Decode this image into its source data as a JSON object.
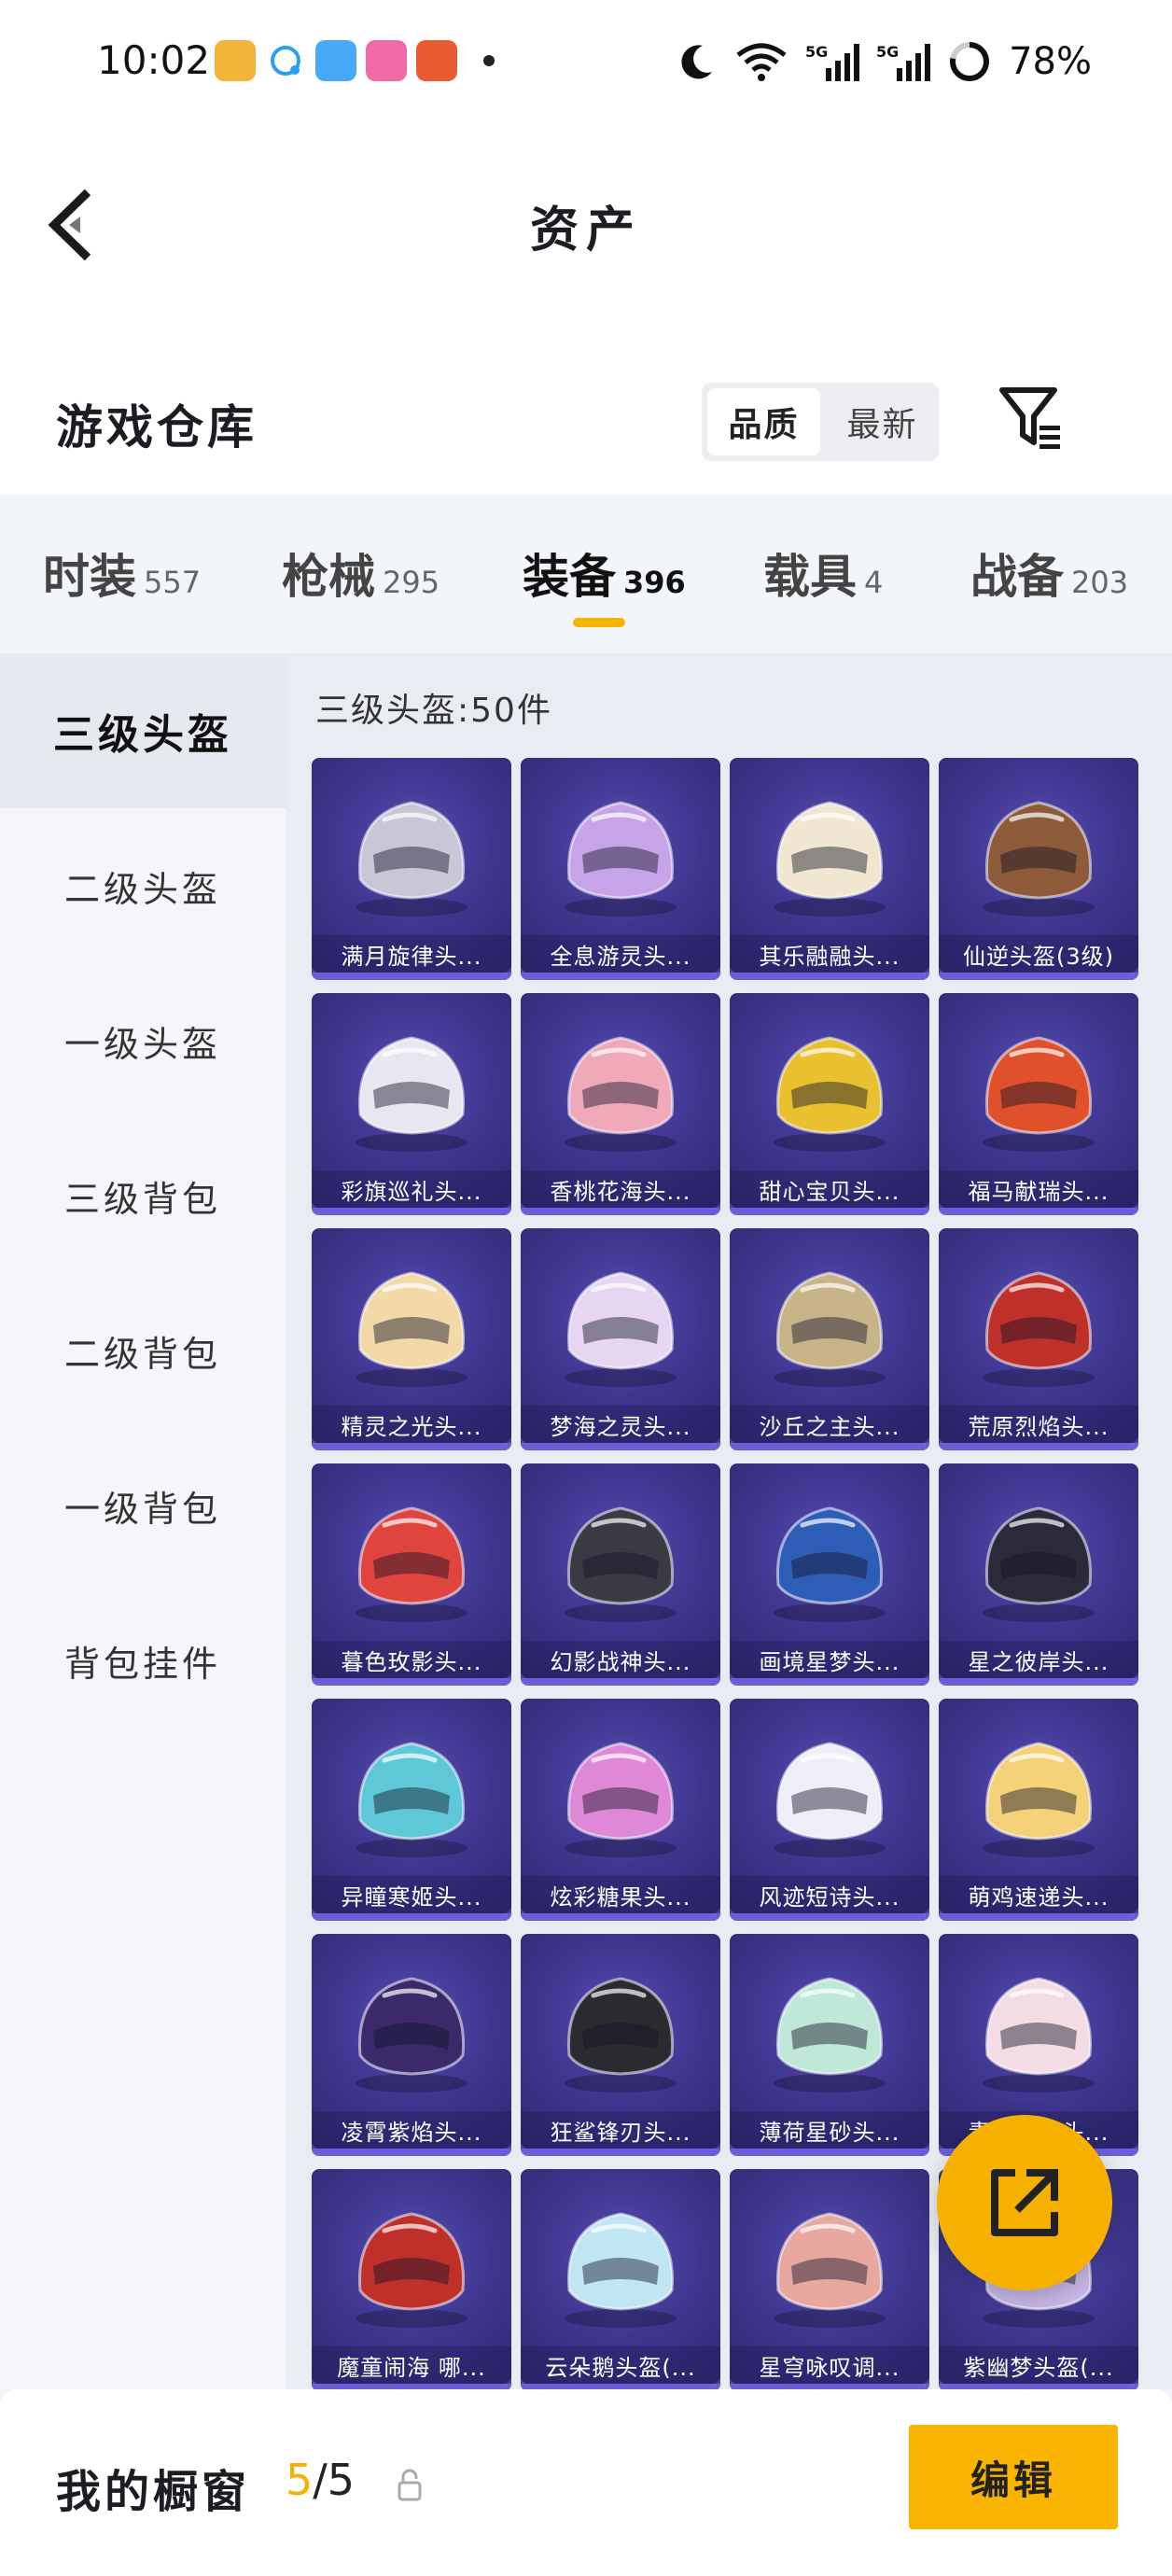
{
  "status_bar": {
    "time": "10:02",
    "battery": "78%",
    "network_1": "5G",
    "network_2": "5G"
  },
  "header": {
    "title": "资产"
  },
  "warehouse": {
    "title": "游戏仓库",
    "sort_options": [
      "品质",
      "最新"
    ],
    "active_sort": "品质"
  },
  "tabs": [
    {
      "label": "时装",
      "count": "557"
    },
    {
      "label": "枪械",
      "count": "295"
    },
    {
      "label": "装备",
      "count": "396"
    },
    {
      "label": "载具",
      "count": "4"
    },
    {
      "label": "战备",
      "count": "203"
    }
  ],
  "active_tab": "装备",
  "sidebar": {
    "items": [
      "三级头盔",
      "二级头盔",
      "一级头盔",
      "三级背包",
      "二级背包",
      "一级背包",
      "背包挂件"
    ],
    "active": "三级头盔"
  },
  "section_label": "三级头盔:50件",
  "items": [
    {
      "name": "满月旋律头...",
      "color": "#c9c6d8"
    },
    {
      "name": "全息游灵头...",
      "color": "#c7a4e8"
    },
    {
      "name": "其乐融融头...",
      "color": "#f1e7d0"
    },
    {
      "name": "仙逆头盔(3级)",
      "color": "#8d5a3a"
    },
    {
      "name": "彩旗巡礼头...",
      "color": "#e8e6f0"
    },
    {
      "name": "香桃花海头...",
      "color": "#f0a9b8"
    },
    {
      "name": "甜心宝贝头...",
      "color": "#e8c030"
    },
    {
      "name": "福马献瑞头...",
      "color": "#e0502a"
    },
    {
      "name": "精灵之光头...",
      "color": "#f3d9a8"
    },
    {
      "name": "梦海之灵头...",
      "color": "#e6d6f2"
    },
    {
      "name": "沙丘之主头...",
      "color": "#c9b48a"
    },
    {
      "name": "荒原烈焰头...",
      "color": "#c0302a"
    },
    {
      "name": "暮色玫影头...",
      "color": "#e0443f"
    },
    {
      "name": "幻影战神头...",
      "color": "#3a3a44"
    },
    {
      "name": "画境星梦头...",
      "color": "#2e5db8"
    },
    {
      "name": "星之彼岸头...",
      "color": "#2a2a3a"
    },
    {
      "name": "异瞳寒姬头...",
      "color": "#5fc8d8"
    },
    {
      "name": "炫彩糖果头...",
      "color": "#e088d8"
    },
    {
      "name": "风迹短诗头...",
      "color": "#eeeef8"
    },
    {
      "name": "萌鸡速递头...",
      "color": "#f5d27a"
    },
    {
      "name": "凌霄紫焰头...",
      "color": "#3a2a6a"
    },
    {
      "name": "狂鲨锋刃头...",
      "color": "#2a2a30"
    },
    {
      "name": "薄荷星砂头...",
      "color": "#bfe8d8"
    },
    {
      "name": "青羊灰灰头...",
      "color": "#f4dce4"
    },
    {
      "name": "魔童闹海 哪...",
      "color": "#c0302a"
    },
    {
      "name": "云朵鹅头盔(...",
      "color": "#bfe6f2"
    },
    {
      "name": "星穹咏叹调...",
      "color": "#e8a8a0"
    },
    {
      "name": "紫幽梦头盔(...",
      "color": "#c8b8e8"
    }
  ],
  "bottom_bar": {
    "label": "我的橱窗",
    "current": "5",
    "total": "/5",
    "edit_label": "编辑"
  },
  "colors": {
    "accent": "#f6b300",
    "card_bg": "#3f3790"
  }
}
